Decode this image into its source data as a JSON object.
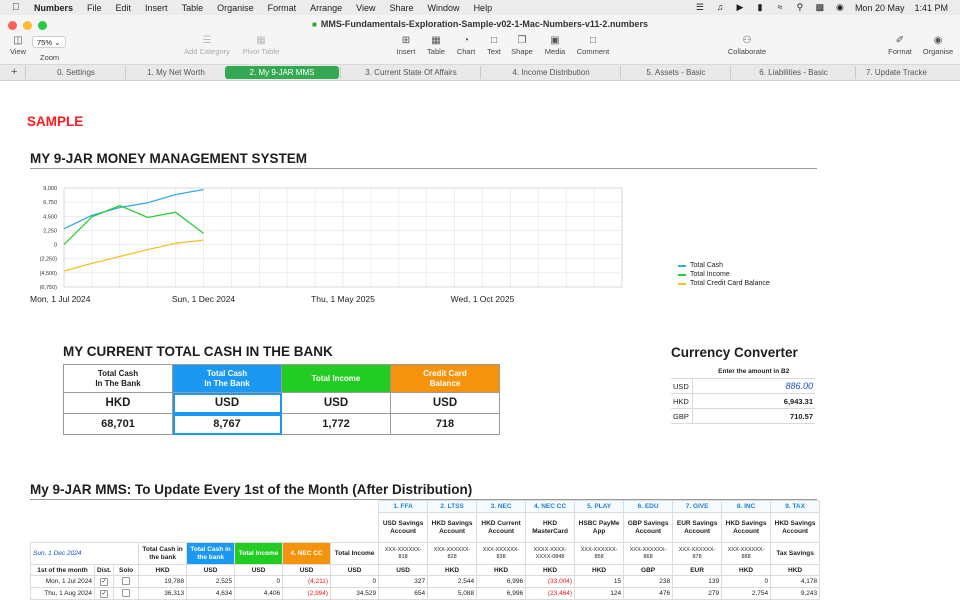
{
  "menubar": {
    "app": "Numbers",
    "items": [
      "File",
      "Edit",
      "Insert",
      "Table",
      "Organise",
      "Format",
      "Arrange",
      "View",
      "Share",
      "Window",
      "Help"
    ],
    "date": "Mon 20 May",
    "time": "1:41 PM"
  },
  "window": {
    "title": "MMS-Fundamentals-Exploration-Sample-v02-1-Mac-Numbers-v11-2.numbers"
  },
  "toolbar": {
    "view": "View",
    "zoom_value": "75%",
    "zoom": "Zoom",
    "add_category": "Add Category",
    "pivot_table": "Pivot Table",
    "insert": "Insert",
    "table": "Table",
    "chart": "Chart",
    "text": "Text",
    "shape": "Shape",
    "media": "Media",
    "comment": "Comment",
    "collaborate": "Collaborate",
    "format": "Format",
    "organise": "Organise"
  },
  "tabs": [
    "0. Settings",
    "1. My Net Worth",
    "2. My 9-JAR MMS",
    "3. Current State Of Affairs",
    "4. Income Distribution",
    "5. Assets - Basic",
    "6. Liabilities - Basic",
    "7. Update Tracke"
  ],
  "sheet": {
    "sample": "SAMPLE",
    "title": "MY 9-JAR MONEY MANAGEMENT SYSTEM",
    "cash_title": "MY CURRENT TOTAL CASH IN THE BANK",
    "mms_title": "My 9-JAR MMS: To Update Every 1st of the Month (After Distribution)"
  },
  "chart_data": {
    "type": "line",
    "x": [
      "2024-07-01",
      "2024-08-01",
      "2024-09-01",
      "2024-10-01",
      "2024-11-01",
      "2024-12-01"
    ],
    "x_tick_labels": [
      "Mon, 1 Jul 2024",
      "Sun, 1 Dec 2024",
      "Thu, 1 May 2025",
      "Wed, 1 Oct 2025"
    ],
    "y_tick_labels": [
      "9,000",
      "6,750",
      "4,500",
      "2,250",
      "0",
      "(2,250)",
      "(4,500)",
      "(6,750)"
    ],
    "ylim": [
      -6750,
      9000
    ],
    "series": [
      {
        "name": "Total Cash",
        "color": "#35a9e8",
        "values": [
          2525,
          4634,
          5900,
          6650,
          7950,
          8767
        ]
      },
      {
        "name": "Total Income",
        "color": "#2bcc3a",
        "values": [
          0,
          4406,
          6200,
          4300,
          5150,
          1772
        ]
      },
      {
        "name": "Total Credit Card Balance",
        "color": "#f5c02a",
        "values": [
          -4211,
          -2994,
          -1900,
          -800,
          200,
          718
        ]
      }
    ],
    "legend": "right",
    "grid": true
  },
  "cash_table": {
    "headers": [
      "Total Cash\nIn The Bank",
      "Total Cash\nIn The Bank",
      "Total Income",
      "Credit Card\nBalance"
    ],
    "currencies": [
      "HKD",
      "USD",
      "USD",
      "USD"
    ],
    "values": [
      "68,701",
      "8,767",
      "1,772",
      "718"
    ]
  },
  "converter": {
    "title": "Currency Converter",
    "note": "Enter the amount in B2",
    "rows": [
      {
        "code": "USD",
        "value": "886.00"
      },
      {
        "code": "HKD",
        "value": "6,943.31"
      },
      {
        "code": "GBP",
        "value": "710.57"
      }
    ]
  },
  "mms": {
    "jars": [
      "1. FFA",
      "2. LTSS",
      "3. NEC",
      "4. NEC CC",
      "5. PLAY",
      "6. EDU",
      "7. GIVE",
      "8. INC",
      "9. TAX"
    ],
    "jar_heads": [
      "USD Savings Account",
      "HKD Savings Account",
      "HKD Current Account",
      "HKD MasterCard",
      "HSBC PayMe App",
      "GBP Savings Account",
      "EUR Savings Account",
      "HKD Savings Account",
      "HKD Savings Account"
    ],
    "accounts": [
      "XXX-XXXXXX-818",
      "XXX-XXXXXX-828",
      "XXX-XXXXXX-838",
      "XXXX-XXXX-XXXX-0848",
      "XXX-XXXXXX-858",
      "XXX-XXXXXX-868",
      "XXX-XXXXXX-878",
      "XXX-XXXXXX-888",
      "Tax Savings"
    ],
    "date": "Sun, 1 Dec 2024",
    "bank_heads": [
      "Total Cash in the bank",
      "Total Cash in the bank",
      "Total Income",
      "4. NEC CC",
      "Total Income"
    ],
    "col_month": "1st of the month",
    "col_dist": "Dist.",
    "col_solo": "Solo",
    "currencies": [
      "HKD",
      "USD",
      "USD",
      "USD",
      "USD",
      "USD",
      "HKD",
      "HKD",
      "HKD",
      "HKD",
      "GBP",
      "EUR",
      "HKD",
      "HKD"
    ],
    "rows": [
      {
        "month": "Mon, 1 Jul 2024",
        "values": [
          "19,788",
          "2,525",
          "0",
          "(4,211)",
          "0",
          "327",
          "2,544",
          "6,996",
          "(33,004)",
          "15",
          "238",
          "139",
          "0",
          "4,178"
        ]
      },
      {
        "month": "Thu, 1 Aug 2024",
        "values": [
          "36,313",
          "4,634",
          "4,406",
          "(2,994)",
          "34,529",
          "654",
          "5,088",
          "6,996",
          "(23,464)",
          "124",
          "476",
          "279",
          "2,754",
          "9,243"
        ]
      }
    ]
  }
}
